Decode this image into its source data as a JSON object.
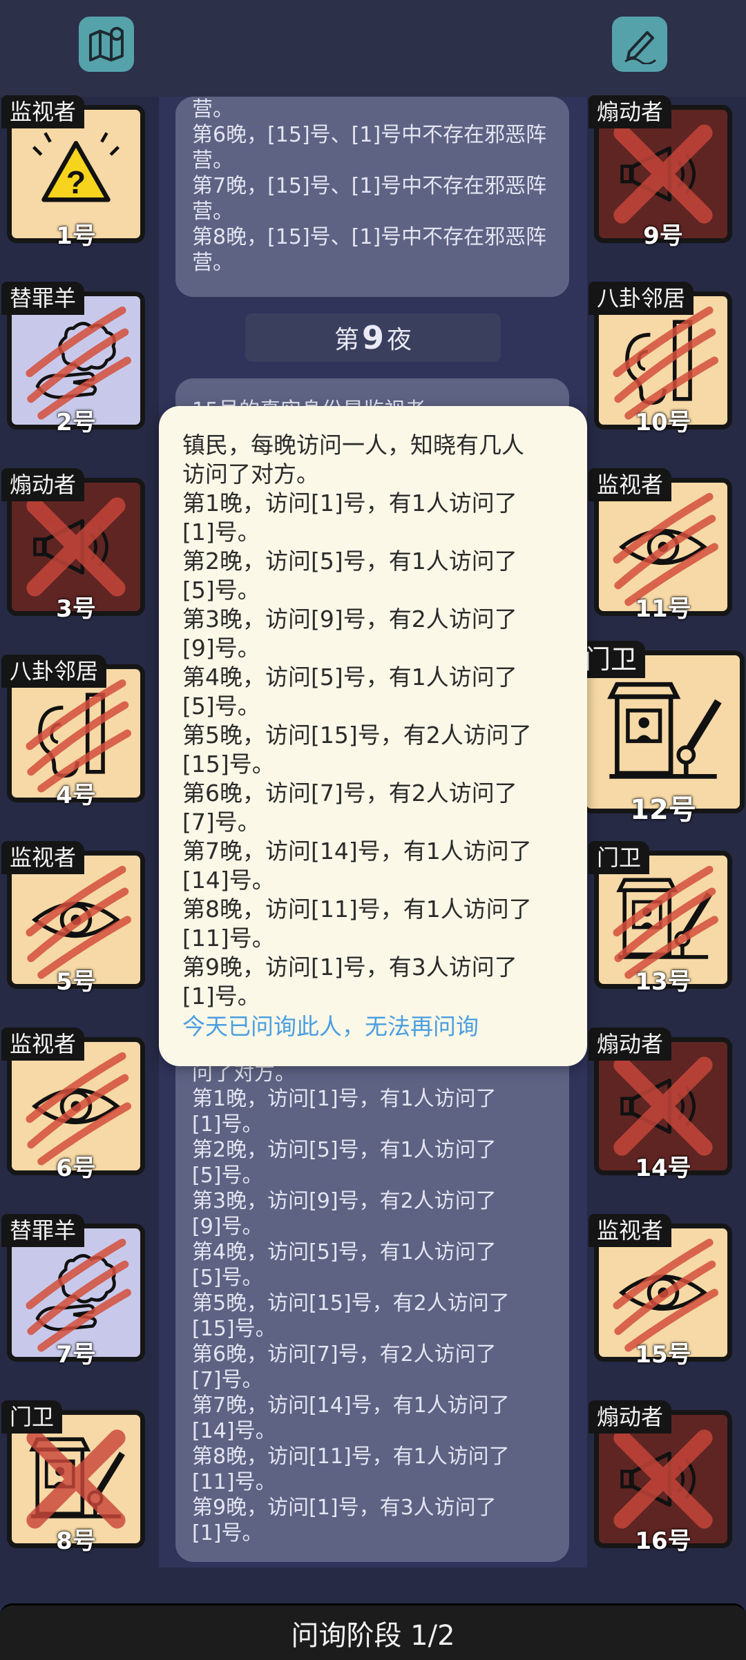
{
  "top": {
    "left_icon": "map-pin-icon",
    "right_icon": "edit-pencil-icon"
  },
  "log_top": [
    "营。",
    "第6晚，[15]号、[1]号中不存在邪恶阵",
    "营。",
    "第7晚，[15]号、[1]号中不存在邪恶阵",
    "营。",
    "第8晚，[15]号、[1]号中不存在邪恶阵",
    "营。"
  ],
  "night": {
    "prefix": "第",
    "number": "9",
    "suffix": "夜"
  },
  "log_mid_partial": "15号的真实身份是监视者",
  "popup": {
    "lines": [
      "镇民，每晚访问一人，知晓有几人",
      "访问了对方。",
      "第1晚，访问[1]号，有1人访问了",
      "[1]号。",
      "第2晚，访问[5]号，有1人访问了",
      "[5]号。",
      "第3晚，访问[9]号，有2人访问了",
      "[9]号。",
      "第4晚，访问[5]号，有1人访问了",
      "[5]号。",
      "第5晚，访问[15]号，有2人访问了",
      "[15]号。",
      "第6晚，访问[7]号，有2人访问了",
      "[7]号。",
      "第7晚，访问[14]号，有1人访问了",
      "[14]号。",
      "第8晚，访问[11]号，有1人访问了",
      "[11]号。",
      "第9晚，访问[1]号，有3人访问了",
      "[1]号。"
    ],
    "notice": "今天已问询此人，无法再问询"
  },
  "log_bottom": [
    "问了对方。",
    "第1晚，访问[1]号，有1人访问了",
    "[1]号。",
    "第2晚，访问[5]号，有1人访问了",
    "[5]号。",
    "第3晚，访问[9]号，有2人访问了",
    "[9]号。",
    "第4晚，访问[5]号，有1人访问了",
    "[5]号。",
    "第5晚，访问[15]号，有2人访问了",
    "[15]号。",
    "第6晚，访问[7]号，有2人访问了",
    "[7]号。",
    "第7晚，访问[14]号，有1人访问了",
    "[14]号。",
    "第8晚，访问[11]号，有1人访问了",
    "[11]号。",
    "第9晚，访问[1]号，有3人访问了",
    "[1]号。"
  ],
  "players": [
    {
      "num": "1号",
      "role": "监视者",
      "icon": "warning-icon",
      "bg": "#f6d9a6",
      "state": "alive"
    },
    {
      "num": "2号",
      "role": "替罪羊",
      "icon": "sheep-hand-icon",
      "bg": "#c8c9ea",
      "state": "clawed"
    },
    {
      "num": "3号",
      "role": "煽动者",
      "icon": "megaphone-icon",
      "bg": "#5f2523",
      "state": "crossed"
    },
    {
      "num": "4号",
      "role": "八卦邻居",
      "icon": "ear-wall-icon",
      "bg": "#f6d9a6",
      "state": "clawed"
    },
    {
      "num": "5号",
      "role": "监视者",
      "icon": "eye-icon",
      "bg": "#f6d9a6",
      "state": "clawed"
    },
    {
      "num": "6号",
      "role": "监视者",
      "icon": "eye-icon",
      "bg": "#f6d9a6",
      "state": "clawed"
    },
    {
      "num": "7号",
      "role": "替罪羊",
      "icon": "sheep-hand-icon",
      "bg": "#c8c9ea",
      "state": "clawed"
    },
    {
      "num": "8号",
      "role": "门卫",
      "icon": "guard-booth-icon",
      "bg": "#f6d9a6",
      "state": "crossed"
    },
    {
      "num": "9号",
      "role": "煽动者",
      "icon": "megaphone-icon",
      "bg": "#5f2523",
      "state": "crossed"
    },
    {
      "num": "10号",
      "role": "八卦邻居",
      "icon": "ear-wall-icon",
      "bg": "#f6d9a6",
      "state": "clawed"
    },
    {
      "num": "11号",
      "role": "监视者",
      "icon": "eye-icon",
      "bg": "#f6d9a6",
      "state": "clawed"
    },
    {
      "num": "12号",
      "role": "门卫",
      "icon": "guard-booth-icon",
      "bg": "#f6d9a6",
      "state": "selected"
    },
    {
      "num": "13号",
      "role": "门卫",
      "icon": "guard-booth-icon",
      "bg": "#f6d9a6",
      "state": "clawed"
    },
    {
      "num": "14号",
      "role": "煽动者",
      "icon": "megaphone-icon",
      "bg": "#5f2523",
      "state": "crossed"
    },
    {
      "num": "15号",
      "role": "监视者",
      "icon": "eye-icon",
      "bg": "#f6d9a6",
      "state": "clawed"
    },
    {
      "num": "16号",
      "role": "煽动者",
      "icon": "megaphone-icon",
      "bg": "#5f2523",
      "state": "crossed"
    }
  ],
  "phase": "问询阶段 1/2"
}
